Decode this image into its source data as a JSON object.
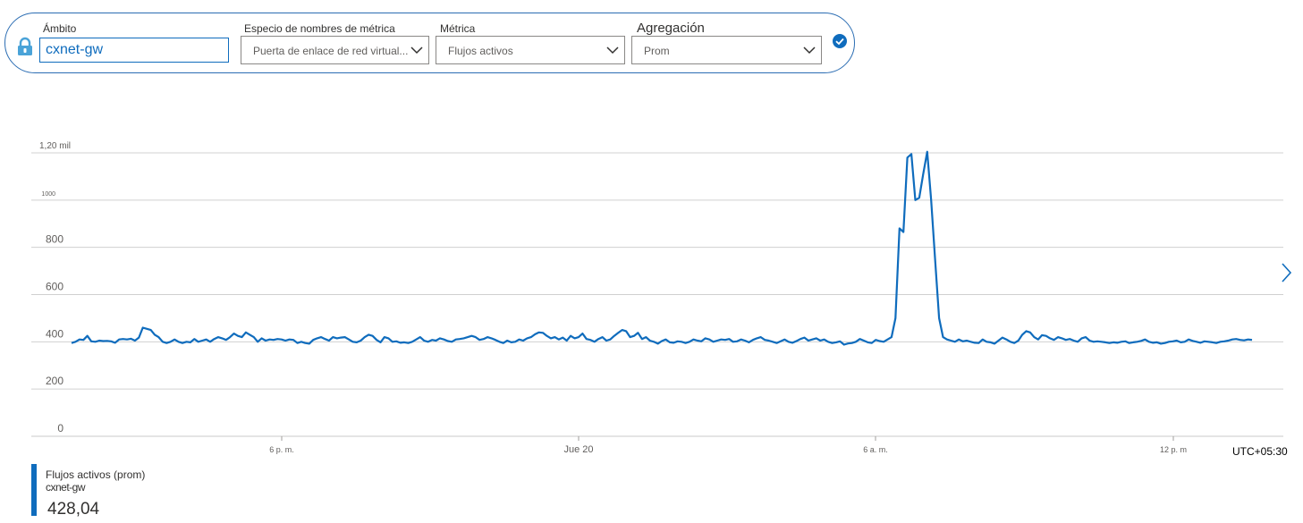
{
  "selector": {
    "scope": {
      "label": "Ámbito",
      "value": "cxnet-gw"
    },
    "namespace": {
      "label": "Especio de nombres de métrica",
      "value": "Puerta de enlace de red virtual..."
    },
    "metric": {
      "label": "Métrica",
      "value": "Flujos activos"
    },
    "aggregation": {
      "label": "Agregación",
      "value": "Prom"
    }
  },
  "chart_data": {
    "type": "line",
    "title": "",
    "xlabel": "",
    "ylabel": "",
    "ylim": [
      0,
      1200
    ],
    "y_ticks": [
      {
        "value": 0,
        "label": "0"
      },
      {
        "value": 200,
        "label": "200"
      },
      {
        "value": 400,
        "label": "400"
      },
      {
        "value": 600,
        "label": "600"
      },
      {
        "value": 800,
        "label": "800"
      },
      {
        "value": 1000,
        "label": "1000"
      },
      {
        "value": 1200,
        "label": "1,20 mil"
      }
    ],
    "x_ticks": [
      "6 p. m.",
      "Jue 20",
      "6 a. m.",
      "12 p. m"
    ],
    "timezone": "UTC+05:30",
    "grid": true,
    "series": [
      {
        "name": "Flujos activos (prom)",
        "color": "#0f6cbd",
        "values": [
          395,
          400,
          410,
          408,
          425,
          402,
          400,
          405,
          403,
          404,
          402,
          396,
          410,
          412,
          410,
          413,
          405,
          418,
          460,
          455,
          450,
          430,
          420,
          400,
          395,
          400,
          410,
          400,
          395,
          400,
          398,
          412,
          400,
          405,
          410,
          400,
          412,
          420,
          415,
          408,
          420,
          435,
          425,
          420,
          440,
          430,
          420,
          400,
          415,
          405,
          410,
          408,
          412,
          410,
          405,
          410,
          408,
          395,
          400,
          395,
          392,
          408,
          415,
          420,
          412,
          405,
          420,
          415,
          418,
          420,
          410,
          400,
          398,
          405,
          420,
          430,
          425,
          408,
          398,
          420,
          415,
          400,
          402,
          396,
          398,
          395,
          400,
          410,
          420,
          405,
          400,
          408,
          405,
          415,
          410,
          403,
          400,
          410,
          412,
          415,
          420,
          425,
          420,
          408,
          412,
          420,
          415,
          408,
          400,
          395,
          405,
          398,
          400,
          410,
          405,
          415,
          420,
          432,
          440,
          438,
          425,
          415,
          420,
          410,
          418,
          405,
          425,
          415,
          420,
          435,
          412,
          408,
          400,
          412,
          420,
          405,
          410,
          425,
          438,
          450,
          445,
          420,
          425,
          438,
          412,
          420,
          405,
          400,
          392,
          403,
          410,
          398,
          396,
          402,
          400,
          395,
          400,
          410,
          405,
          402,
          415,
          410,
          400,
          405,
          410,
          408,
          412,
          400,
          402,
          410,
          405,
          398,
          408,
          415,
          420,
          408,
          405,
          400,
          395,
          402,
          410,
          400,
          396,
          403,
          412,
          418,
          405,
          410,
          415,
          405,
          410,
          400,
          395,
          398,
          402,
          388,
          393,
          395,
          400,
          412,
          405,
          398,
          395,
          408,
          403,
          400,
          410,
          420,
          500,
          880,
          865,
          1180,
          1195,
          1000,
          1010,
          1110,
          1205,
          1000,
          750,
          500,
          420,
          410,
          405,
          400,
          410,
          402,
          405,
          400,
          396,
          395,
          410,
          400,
          398,
          392,
          405,
          418,
          410,
          400,
          395,
          405,
          430,
          445,
          440,
          420,
          410,
          428,
          425,
          415,
          408,
          420,
          415,
          408,
          412,
          405,
          400,
          415,
          420,
          405,
          400,
          402,
          400,
          398,
          395,
          398,
          396,
          400,
          402,
          395,
          398,
          400,
          404,
          410,
          400,
          396,
          398,
          392,
          395,
          400,
          402,
          405,
          398,
          400,
          410,
          404,
          400,
          396,
          402,
          400,
          398,
          395,
          400,
          402,
          405,
          410,
          412,
          408,
          406,
          410,
          408
        ]
      }
    ]
  },
  "legend": {
    "title": "Flujos activos (prom)",
    "scope": "cxnet-gw",
    "value": "428,04"
  }
}
